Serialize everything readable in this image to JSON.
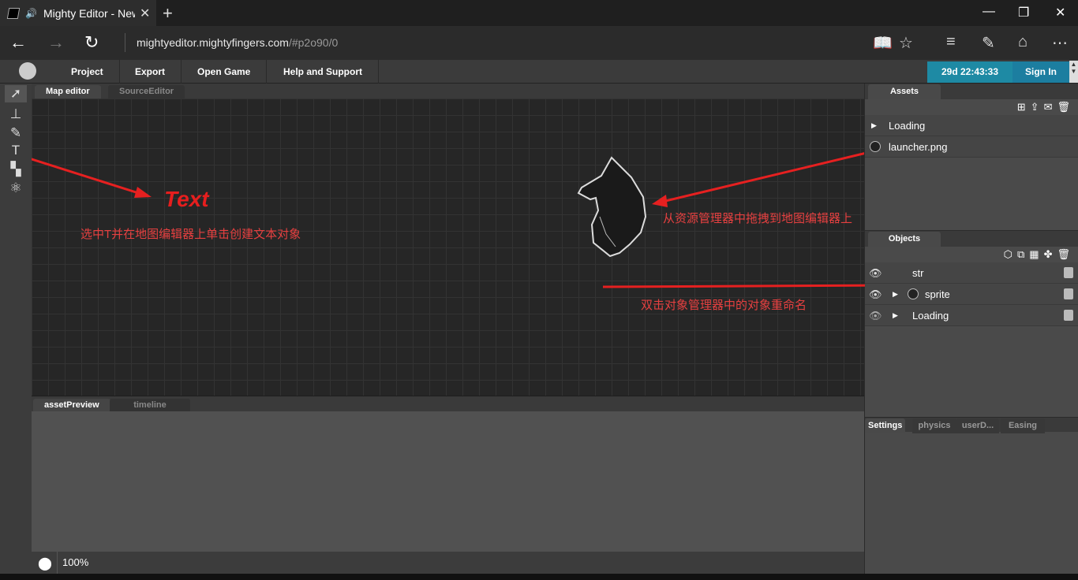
{
  "browser": {
    "tab_title": "Mighty Editor - New",
    "new_tab": "+",
    "url_host": "mightyeditor.mightyfingers.com",
    "url_path": "/#p2o90/0",
    "url_prefix": ""
  },
  "menu": {
    "items": [
      "Project",
      "Export",
      "Open Game",
      "Help and Support"
    ],
    "timer": "29d 22:43:33",
    "sign_in": "Sign In"
  },
  "map_tabs": [
    "Map editor",
    "SourceEditor"
  ],
  "canvas": {
    "text_object": "Text",
    "note_text_tool": "选中T并在地图编辑器上单击创建文本对象",
    "note_drag": "从资源管理器中拖拽到地图编辑器上",
    "note_rename": "双击对象管理器中的对象重命名"
  },
  "preview_tabs": [
    "assetPreview",
    "timeline"
  ],
  "status": {
    "zoom": "100%"
  },
  "assets": {
    "tab": "Assets",
    "items": [
      "Loading",
      "launcher.png"
    ]
  },
  "objects": {
    "tab": "Objects",
    "items": [
      "str",
      "sprite",
      "Loading"
    ]
  },
  "settings_tabs": [
    "Settings",
    "physics",
    "userD...",
    "Easing"
  ]
}
